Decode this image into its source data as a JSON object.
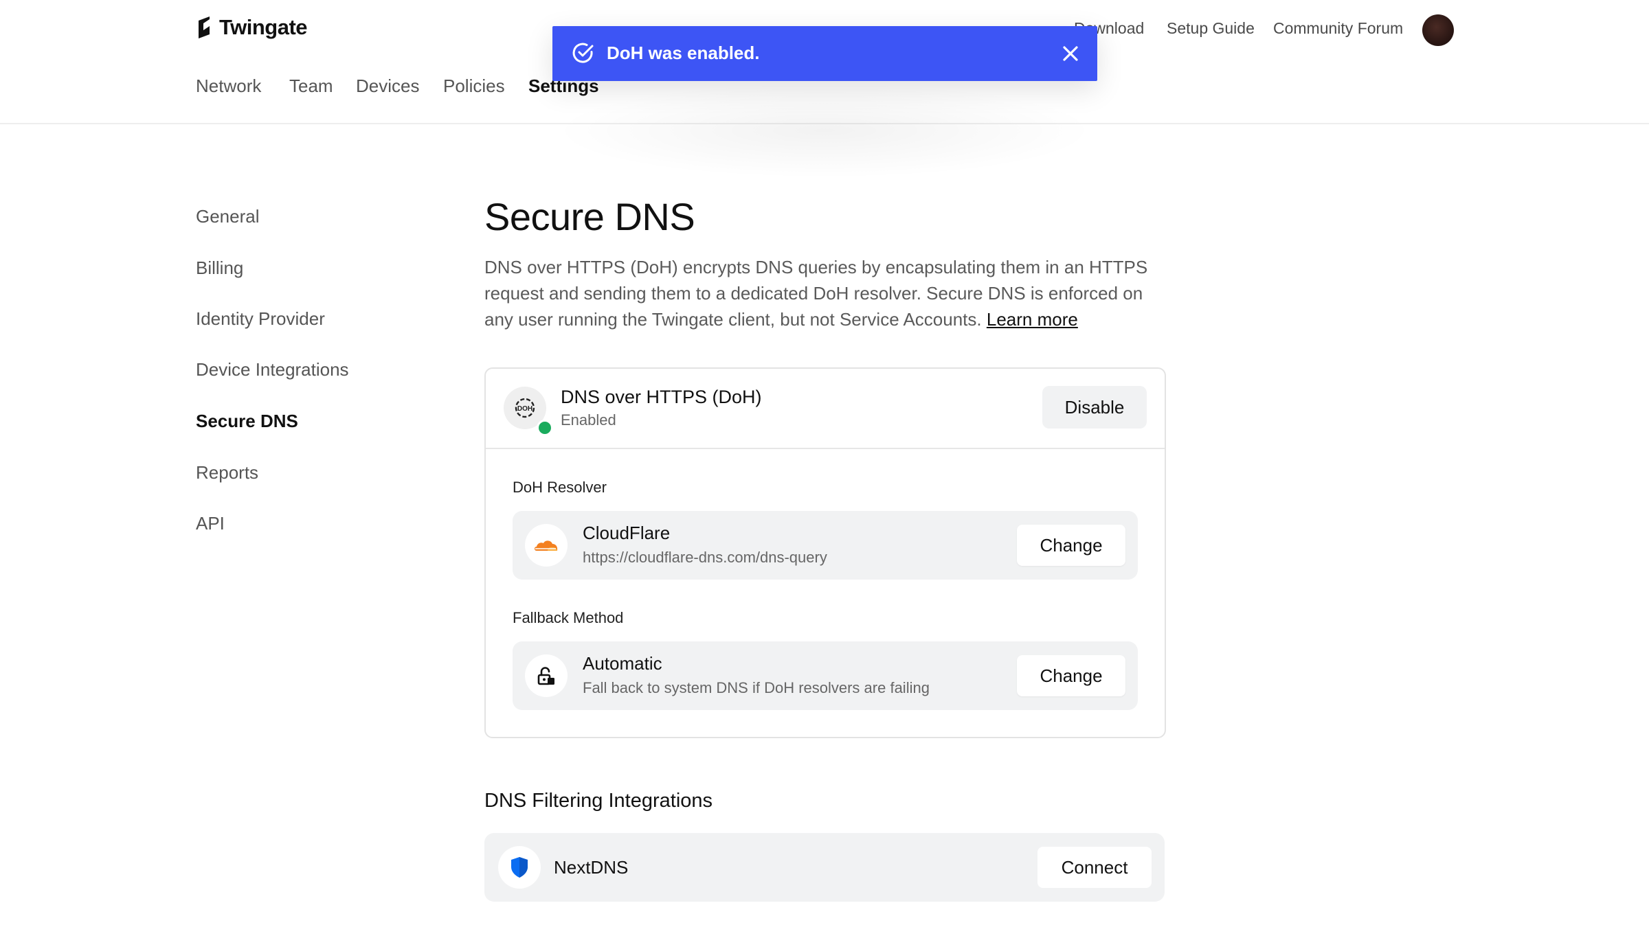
{
  "brand": {
    "name": "Twingate"
  },
  "top_links": [
    "Download",
    "Setup Guide",
    "Community Forum"
  ],
  "main_nav": [
    "Network",
    "Team",
    "Devices",
    "Policies",
    "Settings"
  ],
  "toast": {
    "message": "DoH was enabled.",
    "color": "#3d55f5"
  },
  "sidebar": {
    "items": [
      "General",
      "Billing",
      "Identity Provider",
      "Device Integrations",
      "Secure DNS",
      "Reports",
      "API"
    ],
    "active": "Secure DNS"
  },
  "page": {
    "title": "Secure DNS",
    "description": "DNS over HTTPS (DoH) encrypts DNS queries by encapsulating them in an HTTPS request and sending them to a dedicated DoH resolver. Secure DNS is enforced on any user running the Twingate client, but not Service Accounts.",
    "learn_more": "Learn more"
  },
  "doh": {
    "title": "DNS over HTTPS (DoH)",
    "status": "Enabled",
    "status_color": "#1aab5d",
    "disable_label": "Disable",
    "resolver_label": "DoH Resolver",
    "resolver": {
      "name": "CloudFlare",
      "url": "https://cloudflare-dns.com/dns-query",
      "change_label": "Change"
    },
    "fallback_label": "Fallback Method",
    "fallback": {
      "name": "Automatic",
      "description": "Fall back to system DNS if DoH resolvers are failing",
      "change_label": "Change"
    }
  },
  "filtering": {
    "title": "DNS Filtering Integrations",
    "integrations": [
      {
        "name": "NextDNS",
        "connect_label": "Connect"
      }
    ]
  }
}
